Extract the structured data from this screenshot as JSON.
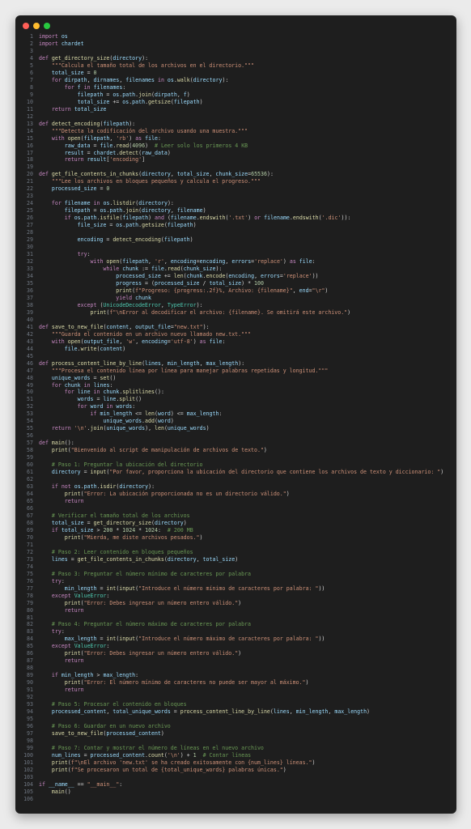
{
  "editor": {
    "title_dots": [
      "close",
      "minimize",
      "zoom"
    ],
    "code_lines": [
      "import os",
      "import chardet",
      "",
      "def get_directory_size(directory):",
      "    \"\"\"Calcula el tamaño total de los archivos en el directorio.\"\"\"",
      "    total_size = 0",
      "    for dirpath, dirnames, filenames in os.walk(directory):",
      "        for f in filenames:",
      "            filepath = os.path.join(dirpath, f)",
      "            total_size += os.path.getsize(filepath)",
      "    return total_size",
      "",
      "def detect_encoding(filepath):",
      "    \"\"\"Detecta la codificación del archivo usando una muestra.\"\"\"",
      "    with open(filepath, 'rb') as file:",
      "        raw_data = file.read(4096)  # Leer solo los primeros 4 KB",
      "        result = chardet.detect(raw_data)",
      "        return result['encoding']",
      "",
      "def get_file_contents_in_chunks(directory, total_size, chunk_size=65536):",
      "    \"\"\"Lee los archivos en bloques pequeños y calcula el progreso.\"\"\"",
      "    processed_size = 0",
      "",
      "    for filename in os.listdir(directory):",
      "        filepath = os.path.join(directory, filename)",
      "        if os.path.isfile(filepath) and (filename.endswith('.txt') or filename.endswith('.dic')):",
      "            file_size = os.path.getsize(filepath)",
      "",
      "            encoding = detect_encoding(filepath)",
      "",
      "            try:",
      "                with open(filepath, 'r', encoding=encoding, errors='replace') as file:",
      "                    while chunk := file.read(chunk_size):",
      "                        processed_size += len(chunk.encode(encoding, errors='replace'))",
      "                        progress = (processed_size / total_size) * 100",
      "                        print(f\"Progreso: {progress:.2f}%, Archivo: {filename}\", end=\"\\r\")",
      "                        yield chunk",
      "            except (UnicodeDecodeError, TypeError):",
      "                print(f\"\\nError al decodificar el archivo: {filename}. Se omitirá este archivo.\")",
      "",
      "def save_to_new_file(content, output_file=\"new.txt\"):",
      "    \"\"\"Guarda el contenido en un archivo nuevo llamado new.txt.\"\"\"",
      "    with open(output_file, 'w', encoding='utf-8') as file:",
      "        file.write(content)",
      "",
      "def process_content_line_by_line(lines, min_length, max_length):",
      "    \"\"\"Procesa el contenido línea por línea para manejar palabras repetidas y longitud.\"\"\"",
      "    unique_words = set()",
      "    for chunk in lines:",
      "        for line in chunk.splitlines():",
      "            words = line.split()",
      "            for word in words:",
      "                if min_length <= len(word) <= max_length:",
      "                    unique_words.add(word)",
      "    return '\\n'.join(unique_words), len(unique_words)",
      "",
      "def main():",
      "    print(\"Bienvenido al script de manipulación de archivos de texto.\")",
      "",
      "    # Paso 1: Preguntar la ubicación del directorio",
      "    directory = input(\"Por favor, proporciona la ubicación del directorio que contiene los archivos de texto y diccionario: \")",
      "",
      "    if not os.path.isdir(directory):",
      "        print(\"Error: La ubicación proporcionada no es un directorio válido.\")",
      "        return",
      "",
      "    # Verificar el tamaño total de los archivos",
      "    total_size = get_directory_size(directory)",
      "    if total_size > 200 * 1024 * 1024:  # 200 MB",
      "        print(\"Mierda, me diste archivos pesados.\")",
      "",
      "    # Paso 2: Leer contenido en bloques pequeños",
      "    lines = get_file_contents_in_chunks(directory, total_size)",
      "",
      "    # Paso 3: Preguntar el número mínimo de caracteres por palabra",
      "    try:",
      "        min_length = int(input(\"Introduce el número mínimo de caracteres por palabra: \"))",
      "    except ValueError:",
      "        print(\"Error: Debes ingresar un número entero válido.\")",
      "        return",
      "",
      "    # Paso 4: Preguntar el número máximo de caracteres por palabra",
      "    try:",
      "        max_length = int(input(\"Introduce el número máximo de caracteres por palabra: \"))",
      "    except ValueError:",
      "        print(\"Error: Debes ingresar un número entero válido.\")",
      "        return",
      "",
      "    if min_length > max_length:",
      "        print(\"Error: El número mínimo de caracteres no puede ser mayor al máximo.\")",
      "        return",
      "",
      "    # Paso 5: Procesar el contenido en bloques",
      "    processed_content, total_unique_words = process_content_line_by_line(lines, min_length, max_length)",
      "",
      "    # Paso 6: Guardar en un nuevo archivo",
      "    save_to_new_file(processed_content)",
      "",
      "    # Paso 7: Contar y mostrar el número de líneas en el nuevo archivo",
      "    num_lines = processed_content.count('\\n') + 1  # Contar líneas",
      "    print(f\"\\nEl archivo 'new.txt' se ha creado exitosamente con {num_lines} líneas.\")",
      "    print(f\"Se procesaron un total de {total_unique_words} palabras únicas.\")",
      "",
      "if __name__ == \"__main__\":",
      "    main()",
      ""
    ]
  }
}
